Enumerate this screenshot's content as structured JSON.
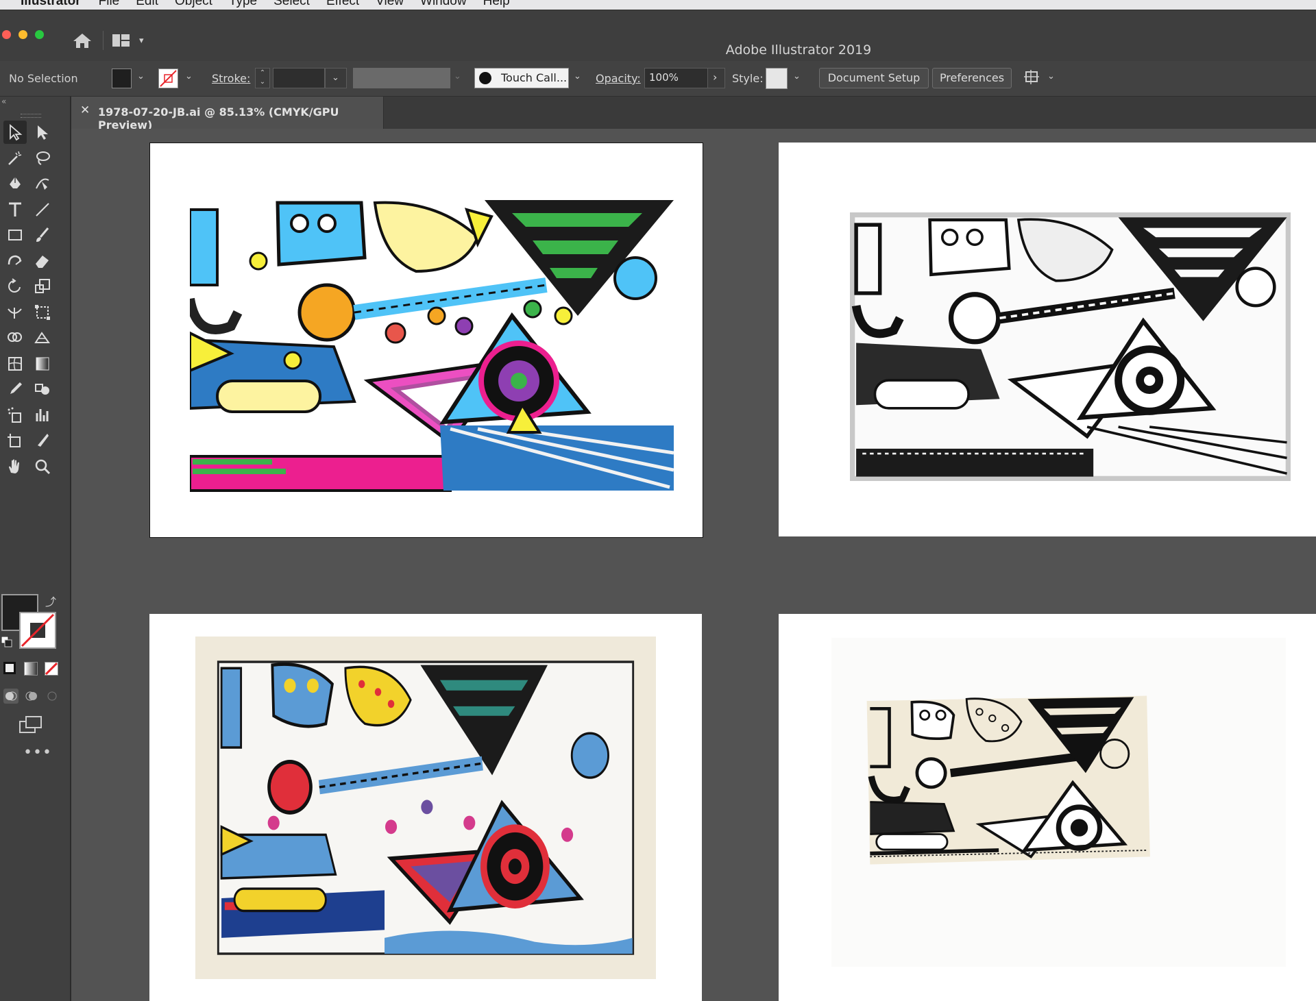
{
  "menubar": {
    "app": "Illustrator",
    "items": [
      "File",
      "Edit",
      "Object",
      "Type",
      "Select",
      "Effect",
      "View",
      "Window",
      "Help"
    ]
  },
  "titlebar": {
    "title": "Adobe Illustrator 2019",
    "traffic_lights": [
      "#ff5f57",
      "#febc2e",
      "#28c840"
    ]
  },
  "controlbar": {
    "selection_label": "No Selection",
    "stroke_label": "Stroke:",
    "brush_label": "Touch Call...",
    "opacity_label": "Opacity:",
    "opacity_value": "100%",
    "style_label": "Style:",
    "document_setup": "Document Setup",
    "preferences": "Preferences"
  },
  "document": {
    "tab_title": "1978-07-20-JB.ai @ 85.13% (CMYK/GPU Preview)",
    "close_icon": "close-icon"
  },
  "tools": [
    "selection-tool-icon",
    "direct-selection-tool-icon",
    "magic-wand-icon",
    "lasso-icon",
    "pen-tool-icon",
    "curvature-tool-icon",
    "type-tool-icon",
    "line-tool-icon",
    "rectangle-tool-icon",
    "paintbrush-icon",
    "shaper-tool-icon",
    "eraser-icon",
    "rotate-tool-icon",
    "scale-tool-icon",
    "width-tool-icon",
    "free-transform-icon",
    "shape-builder-icon",
    "perspective-grid-icon",
    "mesh-tool-icon",
    "gradient-tool-icon",
    "eyedropper-icon",
    "blend-tool-icon",
    "symbol-sprayer-icon",
    "column-graph-icon",
    "artboard-tool-icon",
    "slice-tool-icon",
    "hand-tool-icon",
    "zoom-tool-icon"
  ],
  "colors": {
    "ui_dark": "#3e3e3e",
    "canvas_bg": "#535353",
    "fill_swatch": "#1f1f1f",
    "stroke_none": "#e8242a"
  },
  "artboards": [
    {
      "name": "artboard-color-vector",
      "palette": [
        "#4fc3f7",
        "#f7ef3a",
        "#ec1f8f",
        "#8e3fb2",
        "#3bb34a",
        "#e8564b",
        "#f6d63a",
        "#f5a623"
      ]
    },
    {
      "name": "artboard-bw-vector",
      "palette": [
        "#1b1b1b",
        "#ffffff",
        "#c8c8c8"
      ]
    },
    {
      "name": "artboard-color-photo",
      "palette": [
        "#5b9bd5",
        "#e02f3a",
        "#f2d22b",
        "#2f8a7e",
        "#d43b8c",
        "#6b4fa0",
        "#f0f0ee"
      ]
    },
    {
      "name": "artboard-sketch-photo",
      "palette": [
        "#1a1a1a",
        "#f1ead8",
        "#ffffff"
      ]
    }
  ]
}
